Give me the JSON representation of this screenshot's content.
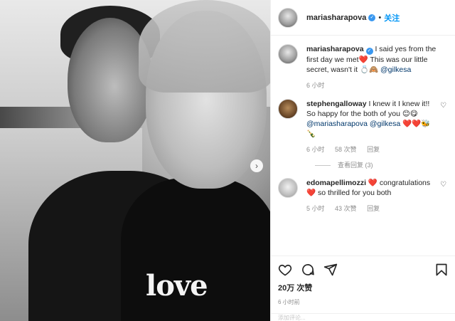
{
  "post": {
    "author": "mariasharapova",
    "follow_separator": "•",
    "follow_label": "关注",
    "photo_text": "love",
    "next_icon": "chevron-right-icon"
  },
  "comments": [
    {
      "user": "mariasharapova",
      "text": " I said yes from the first day we met❤️ This was our little secret, wasn't it 💍🙈 ",
      "mention": "@gilkesa",
      "time": "6 小时"
    },
    {
      "user": "stephengalloway",
      "text": " I knew it I knew it!! So happy for the both of you 😊😋 ",
      "mention": "@mariasharapova @gilkesa",
      "emoji_tail": " ❤️❤️🐝🍾",
      "time": "6 小时",
      "likes": "58 次赞",
      "reply": "回复",
      "view_replies": "查看回复 (3)"
    },
    {
      "user": "edomapellimozzi",
      "text": " ❤️ congratulations ❤️ so thrilled for you both",
      "time": "5 小时",
      "likes": "43 次赞",
      "reply": "回复"
    }
  ],
  "footer": {
    "likes": "20万 次赞",
    "time_ago": "6 小时前",
    "add_comment": "添加评论..."
  }
}
